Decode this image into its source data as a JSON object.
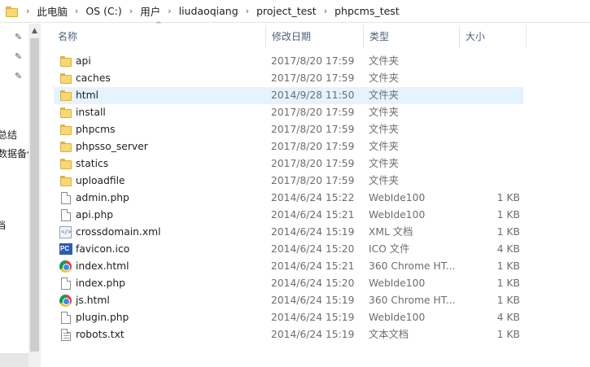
{
  "breadcrumbs": [
    "此电脑",
    "OS (C:)",
    "用户",
    "liudaoqiang",
    "project_test",
    "phpcms_test"
  ],
  "nav": {
    "items": [
      "总结",
      "数据备份",
      "档"
    ],
    "icons": [
      "pin-icon",
      "pin-icon",
      "pin-icon"
    ]
  },
  "columns": {
    "name": "名称",
    "date": "修改日期",
    "type": "类型",
    "size": "大小"
  },
  "files": [
    {
      "name": "api",
      "date": "2017/8/20 17:59",
      "type": "文件夹",
      "size": "",
      "icon": "folder-icon",
      "selected": false
    },
    {
      "name": "caches",
      "date": "2017/8/20 17:59",
      "type": "文件夹",
      "size": "",
      "icon": "folder-icon",
      "selected": false
    },
    {
      "name": "html",
      "date": "2014/9/28 11:50",
      "type": "文件夹",
      "size": "",
      "icon": "folder-icon",
      "selected": true
    },
    {
      "name": "install",
      "date": "2017/8/20 17:59",
      "type": "文件夹",
      "size": "",
      "icon": "folder-icon",
      "selected": false
    },
    {
      "name": "phpcms",
      "date": "2017/8/20 17:59",
      "type": "文件夹",
      "size": "",
      "icon": "folder-icon",
      "selected": false
    },
    {
      "name": "phpsso_server",
      "date": "2017/8/20 17:59",
      "type": "文件夹",
      "size": "",
      "icon": "folder-icon",
      "selected": false
    },
    {
      "name": "statics",
      "date": "2017/8/20 17:59",
      "type": "文件夹",
      "size": "",
      "icon": "folder-icon",
      "selected": false
    },
    {
      "name": "uploadfile",
      "date": "2017/8/20 17:59",
      "type": "文件夹",
      "size": "",
      "icon": "folder-icon",
      "selected": false
    },
    {
      "name": "admin.php",
      "date": "2014/6/24 15:22",
      "type": "WebIde100",
      "size": "1 KB",
      "icon": "document-icon",
      "selected": false
    },
    {
      "name": "api.php",
      "date": "2014/6/24 15:21",
      "type": "WebIde100",
      "size": "1 KB",
      "icon": "document-icon",
      "selected": false
    },
    {
      "name": "crossdomain.xml",
      "date": "2014/6/24 15:19",
      "type": "XML 文档",
      "size": "1 KB",
      "icon": "xml-file-icon",
      "selected": false
    },
    {
      "name": "favicon.ico",
      "date": "2014/6/24 15:20",
      "type": "ICO 文件",
      "size": "4 KB",
      "icon": "ico-file-icon",
      "selected": false
    },
    {
      "name": "index.html",
      "date": "2014/6/24 15:21",
      "type": "360 Chrome HT...",
      "size": "1 KB",
      "icon": "chrome-html-icon",
      "selected": false
    },
    {
      "name": "index.php",
      "date": "2014/6/24 15:20",
      "type": "WebIde100",
      "size": "1 KB",
      "icon": "document-icon",
      "selected": false
    },
    {
      "name": "js.html",
      "date": "2014/6/24 15:19",
      "type": "360 Chrome HT...",
      "size": "1 KB",
      "icon": "chrome-html-icon",
      "selected": false
    },
    {
      "name": "plugin.php",
      "date": "2014/6/24 15:19",
      "type": "WebIde100",
      "size": "4 KB",
      "icon": "document-icon",
      "selected": false
    },
    {
      "name": "robots.txt",
      "date": "2014/6/24 15:19",
      "type": "文本文档",
      "size": "1 KB",
      "icon": "text-file-icon",
      "selected": false
    }
  ],
  "ico_badge": "PC",
  "colors": {
    "selected_row": "#e5f3ff",
    "header_text": "#4c607a",
    "folder": "#f8d775"
  }
}
